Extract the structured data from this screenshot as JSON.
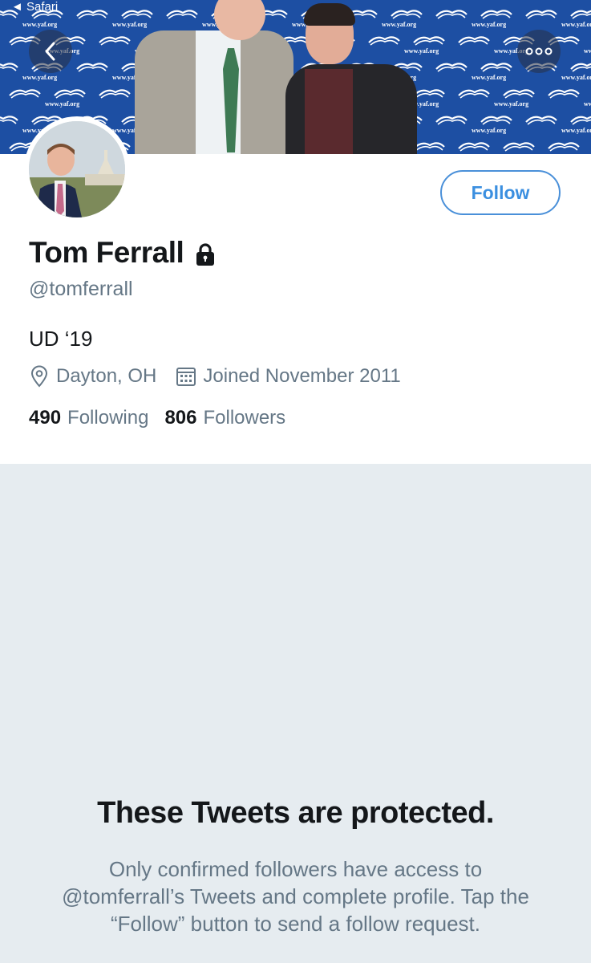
{
  "status_bar": {
    "back_app_label": "◄ Safari"
  },
  "banner": {
    "url_text": "www.yaf.org",
    "colors": {
      "background": "#1d4fa3",
      "text": "#ffffff"
    }
  },
  "nav": {
    "back_icon": "chevron-left-icon",
    "more_icon": "more-dots-icon"
  },
  "profile": {
    "name": "Tom Ferrall",
    "protected_icon": "lock-icon",
    "handle": "@tomferrall",
    "bio": "UD ‘19",
    "location": "Dayton, OH",
    "joined": "Joined November 2011",
    "following_count": "490",
    "following_label": "Following",
    "followers_count": "806",
    "followers_label": "Followers",
    "follow_button": "Follow"
  },
  "protected": {
    "title": "These Tweets are protected.",
    "message": "Only confirmed followers have access to @tomferrall’s Tweets and complete profile. Tap the “Follow” button to send a follow request."
  },
  "colors": {
    "accent": "#1da1f2",
    "secondary_text": "#657786",
    "protected_bg": "#e6ecf0"
  }
}
